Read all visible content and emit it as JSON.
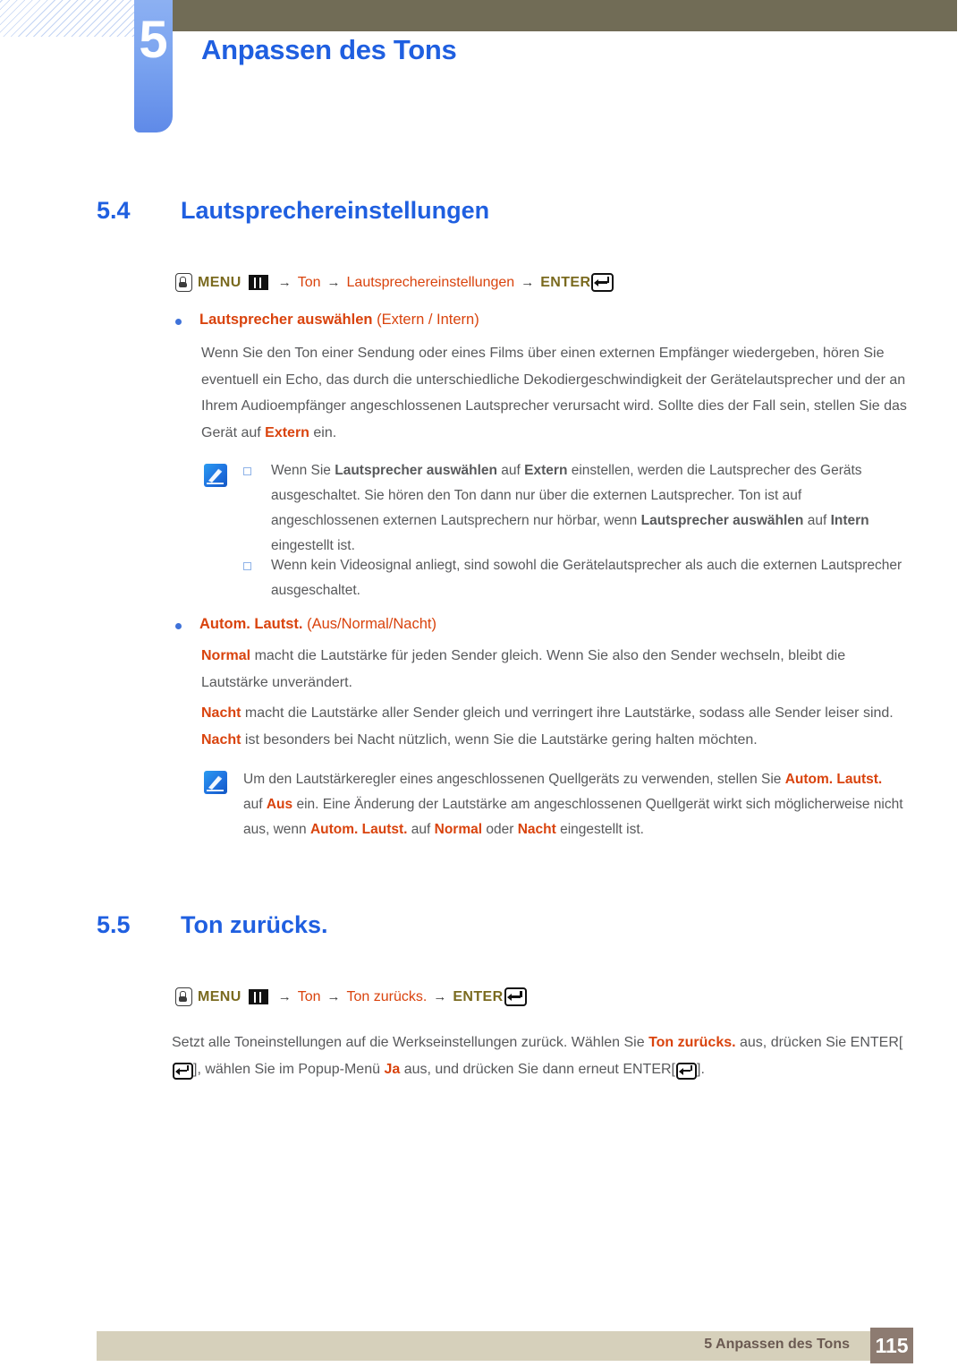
{
  "header": {
    "chapter_number": "5",
    "chapter_title": "Anpassen des Tons",
    "accent_blue": "#1f5fe0",
    "olive_bar_color": "#716c56"
  },
  "sections": [
    {
      "number": "5.4",
      "title": "Lautsprechereinstellungen",
      "menu_path": {
        "hand_icon": "hand-press-icon",
        "menu_label": "MENU",
        "bars_icon": "menu-bars-icon",
        "arrow": "→",
        "step1": "Ton",
        "step2": "Lautsprechereinstellungen",
        "enter_label": "ENTER",
        "enter_icon": "enter-key-icon"
      }
    },
    {
      "number": "5.5",
      "title": "Ton zurücks.",
      "menu_path": {
        "hand_icon": "hand-press-icon",
        "menu_label": "MENU",
        "bars_icon": "menu-bars-icon",
        "arrow": "→",
        "step1": "Ton",
        "step2": "Ton zurücks.",
        "enter_label": "ENTER",
        "enter_icon": "enter-key-icon"
      }
    }
  ],
  "bullets": {
    "speaker_select": {
      "bold": "Lautsprecher auswählen",
      "options": "(Extern / Intern)"
    },
    "auto_volume": {
      "bold": "Autom. Lautst.",
      "options": "(Aus/Normal/Nacht)"
    }
  },
  "paragraphs": {
    "speaker_body": {
      "line1": "Wenn Sie den Ton einer Sendung oder eines Films über einen externen Empfänger wiedergeben,",
      "line2": "hören Sie eventuell ein Echo, das durch die unterschiedliche Dekodiergeschwindigkeit der",
      "line3": "Gerätelautsprecher und der an Ihrem Audioempfänger angeschlossenen Lautsprecher verursacht",
      "line4_a": "wird. Sollte dies der Fall sein, stellen Sie das Gerät auf ",
      "line4_hl": "Extern",
      "line4_b": " ein."
    },
    "note1_item1": {
      "a": "Wenn Sie ",
      "hl1": "Lautsprecher auswählen",
      "b": " auf ",
      "hl2": "Extern",
      "c": " einstellen, werden die Lautsprecher des Geräts ausgeschaltet. Sie hören den Ton dann nur über die externen Lautsprecher. Ton ist auf angeschlossenen externen Lautsprechern nur hörbar, wenn ",
      "hl3": "Lautsprecher auswählen",
      "d": " auf ",
      "hl4": "Intern",
      "e": " eingestellt ist."
    },
    "note1_item2": {
      "text": "Wenn kein Videosignal anliegt, sind sowohl die Gerätelautsprecher als auch die externen Lautsprecher ausgeschaltet."
    },
    "normal_para": {
      "hl": "Normal",
      "rest": " macht die Lautstärke für jeden Sender gleich. Wenn Sie also den Sender wechseln, bleibt die Lautstärke unverändert."
    },
    "nacht_para": {
      "hl1": "Nacht",
      "a": " macht die Lautstärke aller Sender gleich und verringert ihre Lautstärke, sodass alle Sender leiser sind. ",
      "hl2": "Nacht",
      "b": " ist besonders bei Nacht nützlich, wenn Sie die Lautstärke gering halten möchten."
    },
    "note2": {
      "a": "Um den Lautstärkeregler eines angeschlossenen Quellgeräts zu verwenden, stellen Sie ",
      "hl1": "Autom. Lautst.",
      "b": " auf ",
      "hl2": "Aus",
      "c": " ein. Eine Änderung der Lautstärke am angeschlossenen Quellgerät wirkt sich möglicherweise nicht aus, wenn ",
      "hl3": "Autom. Lautst.",
      "d": " auf ",
      "hl4": "Normal",
      "e": " oder ",
      "hl5": "Nacht",
      "f": " eingestellt ist."
    },
    "reset_para": {
      "a": "Setzt alle Toneinstellungen auf die Werkseinstellungen zurück. Wählen Sie ",
      "hl1": "Ton zurücks.",
      "b": " aus, drücken Sie ",
      "hl2": "ENTER",
      "c": "[",
      "d": "], wählen Sie im Popup-Menü ",
      "hl3": "Ja",
      "e": " aus, und drücken Sie dann erneut ",
      "hl4": "ENTER",
      "f": "[",
      "g": "]."
    }
  },
  "note_icon_name": "note-pencil-icon",
  "footer": {
    "text": "5 Anpassen des Tons",
    "page_number": "115",
    "bar_color": "#d6d0bb",
    "page_box_color": "#8d7b71"
  }
}
